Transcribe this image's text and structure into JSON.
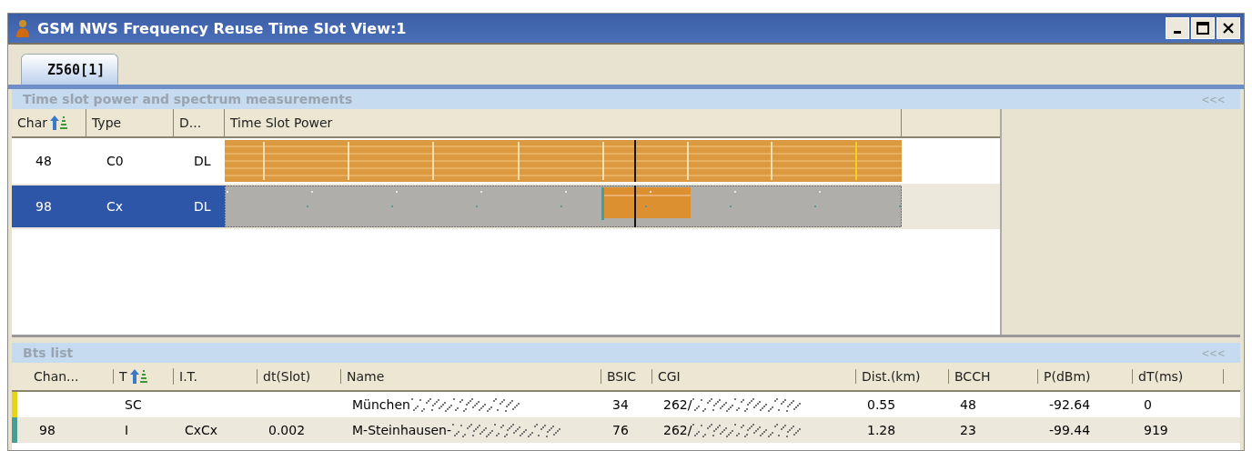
{
  "window": {
    "title": "GSM NWS Frequency Reuse Time Slot View:1"
  },
  "tabs": [
    {
      "label": "Z560[1]",
      "selected": true
    }
  ],
  "slot_panel": {
    "title": "Time slot power and spectrum measurements",
    "collapse": "<<<",
    "columns": [
      "Char",
      "Type",
      "D...",
      "Time Slot Power"
    ],
    "rows": [
      {
        "cells": [
          "48",
          "C0",
          "DL"
        ],
        "selected": false
      },
      {
        "cells": [
          "98",
          "Cx",
          "DL"
        ],
        "selected": true
      }
    ]
  },
  "bts_list": {
    "title": "Bts list",
    "collapse": "<<<",
    "columns": [
      "Chan...",
      "T",
      "I.T.",
      "dt(Slot)",
      "Name",
      "BSIC",
      "CGI",
      "Dist.(km)",
      "BCCH",
      "P(dBm)",
      "dT(ms)"
    ],
    "rows": [
      {
        "color": "#e6d31c",
        "cells": [
          "",
          "SC",
          "",
          "",
          "München",
          "34",
          "262/",
          "0.55",
          "48",
          "-92.64",
          "0"
        ]
      },
      {
        "color": "#4a9c94",
        "cells": [
          "98",
          "I",
          "CxCx",
          "0.002",
          "M-Steinhausen-",
          "76",
          "262/",
          "1.28",
          "23",
          "-99.44",
          "919"
        ]
      }
    ]
  }
}
